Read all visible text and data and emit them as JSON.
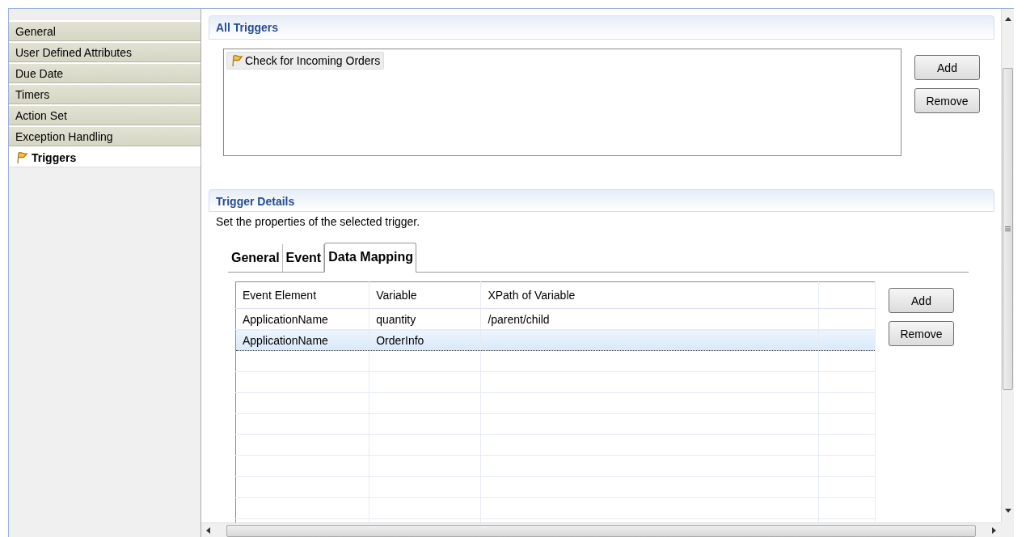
{
  "sidebar": {
    "items": [
      {
        "label": "General",
        "selected": false
      },
      {
        "label": "User Defined Attributes",
        "selected": false
      },
      {
        "label": "Due Date",
        "selected": false
      },
      {
        "label": "Timers",
        "selected": false
      },
      {
        "label": "Action Set",
        "selected": false
      },
      {
        "label": "Exception Handling",
        "selected": false
      },
      {
        "label": "Triggers",
        "selected": true
      }
    ]
  },
  "all_triggers": {
    "title": "All Triggers",
    "items": [
      {
        "label": "Check for Incoming Orders",
        "selected": true
      }
    ],
    "buttons": [
      "Add",
      "Remove"
    ]
  },
  "trigger_details": {
    "title": "Trigger Details",
    "description": "Set the properties of the selected trigger.",
    "tabs": [
      {
        "label": "General",
        "selected": false
      },
      {
        "label": "Event",
        "selected": false
      },
      {
        "label": "Data Mapping",
        "selected": true
      }
    ],
    "table": {
      "columns": [
        "Event Element",
        "Variable",
        "XPath of Variable"
      ],
      "rows": [
        {
          "cells": [
            "ApplicationName",
            "quantity",
            "/parent/child"
          ],
          "selected": false
        },
        {
          "cells": [
            "ApplicationName",
            "OrderInfo"
          ],
          "selected": true
        }
      ]
    },
    "buttons": [
      "Add",
      "Remove"
    ]
  }
}
